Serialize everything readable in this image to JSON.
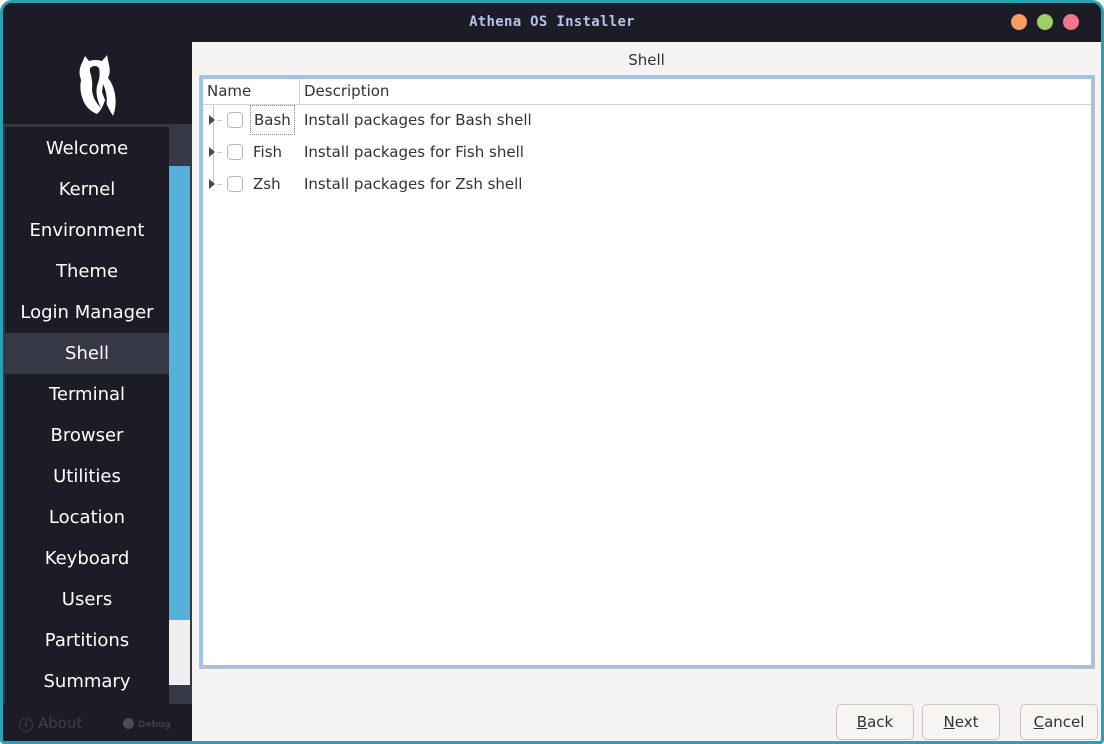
{
  "window": {
    "title": "Athena OS Installer",
    "controls": {
      "minimize_color": "#f99c5f",
      "maximize_color": "#a0cd64",
      "close_color": "#f0758f"
    },
    "border_color": "#2aa1b3"
  },
  "sidebar": {
    "logo": "athena-owl-logo",
    "items": [
      {
        "label": "Welcome",
        "selected": false
      },
      {
        "label": "Kernel",
        "selected": false
      },
      {
        "label": "Environment",
        "selected": false
      },
      {
        "label": "Theme",
        "selected": false
      },
      {
        "label": "Login Manager",
        "selected": false
      },
      {
        "label": "Shell",
        "selected": true
      },
      {
        "label": "Terminal",
        "selected": false
      },
      {
        "label": "Browser",
        "selected": false
      },
      {
        "label": "Utilities",
        "selected": false
      },
      {
        "label": "Location",
        "selected": false
      },
      {
        "label": "Keyboard",
        "selected": false
      },
      {
        "label": "Users",
        "selected": false
      },
      {
        "label": "Partitions",
        "selected": false
      },
      {
        "label": "Summary",
        "selected": false
      }
    ],
    "footer": {
      "about_icon": "info-icon",
      "about_label": "About",
      "debug_label": "Debug"
    },
    "accent_color": "#55b1d9"
  },
  "content": {
    "page_title": "Shell",
    "tree": {
      "columns": [
        "Name",
        "Description"
      ],
      "rows": [
        {
          "name": "Bash",
          "description": "Install packages for Bash shell",
          "checked": false,
          "expanded": false,
          "focused": true
        },
        {
          "name": "Fish",
          "description": "Install packages for Fish shell",
          "checked": false,
          "expanded": false,
          "focused": false
        },
        {
          "name": "Zsh",
          "description": "Install packages for Zsh shell",
          "checked": false,
          "expanded": false,
          "focused": false
        }
      ]
    }
  },
  "buttons": {
    "back": {
      "mnemonic": "B",
      "rest": "ack"
    },
    "next": {
      "mnemonic": "N",
      "rest": "ext"
    },
    "cancel": {
      "mnemonic": "C",
      "rest": "ancel"
    }
  }
}
